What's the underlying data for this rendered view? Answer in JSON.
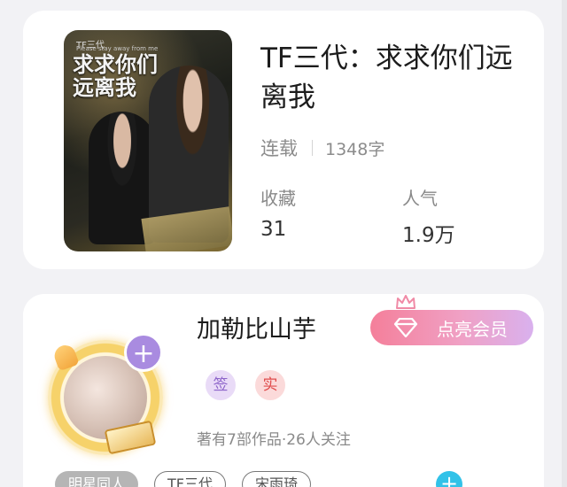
{
  "book": {
    "cover": {
      "brand": "TF三代",
      "subtitle": "Please stay away from me",
      "title_line1": "求求你们",
      "title_line2": "远离我"
    },
    "title": "TF三代：求求你们远离我",
    "status": "连载",
    "word_count": "1348字",
    "favorites_label": "收藏",
    "favorites_value": "31",
    "popularity_label": "人气",
    "popularity_value": "1.9万"
  },
  "author": {
    "name": "加勒比山芋",
    "vip_button": "点亮会员",
    "follow_icon": "+",
    "badge_signed": "签",
    "badge_verified": "实",
    "stats": "著有7部作品·26人关注",
    "tags": [
      "明星同人",
      "TF三代",
      "宋雨琦"
    ],
    "add_tag_icon": "+"
  },
  "colors": {
    "background": "#f2f2f5",
    "follow_button": "#a98be0",
    "vip_gradient_start": "#f47f9a",
    "vip_gradient_end": "#d9b1ee",
    "add_tag": "#32c2e8"
  }
}
